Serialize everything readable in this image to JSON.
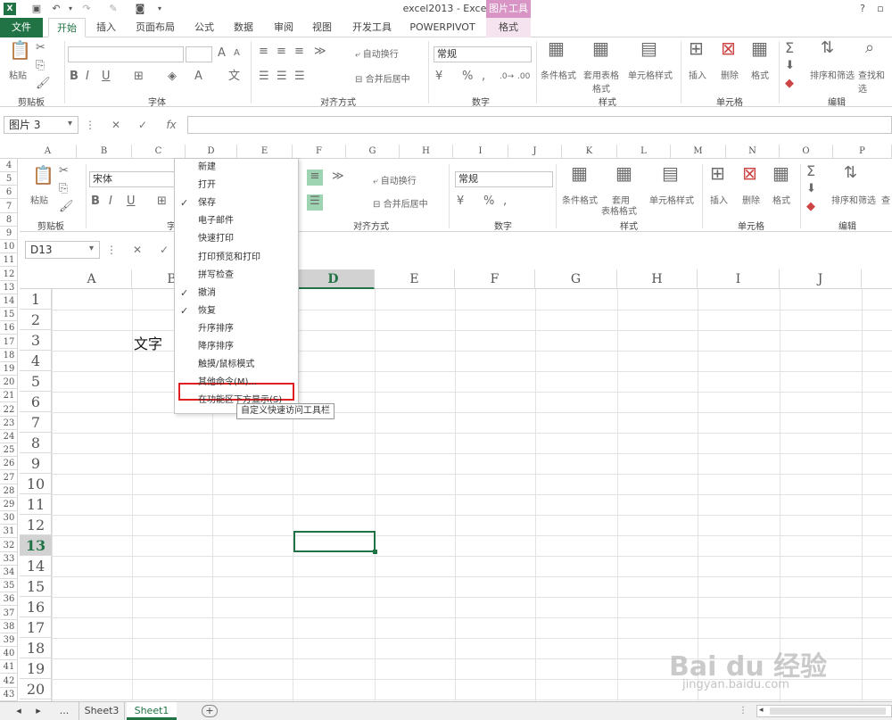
{
  "window": {
    "title": "excel2013 - Excel",
    "contextual_tab_group": "图片工具",
    "help": "?"
  },
  "tabs": [
    "文件",
    "开始",
    "插入",
    "页面布局",
    "公式",
    "数据",
    "审阅",
    "视图",
    "开发工具",
    "POWERPIVOT",
    "格式"
  ],
  "ribbon1": {
    "clipboard": {
      "paste": "粘贴",
      "group": "剪贴板"
    },
    "font": {
      "group": "字体",
      "bold": "B",
      "italic": "I",
      "underline": "U"
    },
    "alignment": {
      "wrap": "自动换行",
      "merge": "合并后居中",
      "group": "对齐方式"
    },
    "number": {
      "format": "常规",
      "group": "数字",
      "percent": "%"
    },
    "styles": {
      "conditional": "条件格式",
      "table": "套用表格格式",
      "cell": "单元格样式",
      "group": "样式"
    },
    "cells": {
      "insert": "插入",
      "delete": "删除",
      "format": "格式",
      "group": "单元格"
    },
    "editing": {
      "sort": "排序和筛选",
      "find": "查找和选",
      "group": "编辑"
    }
  },
  "formula_bar1": {
    "namebox": "图片 3",
    "fx": "fx"
  },
  "ribbon2": {
    "font_name": "宋体",
    "paste": "粘贴",
    "clipboard": "剪贴板",
    "font_group": "字",
    "wrap": "自动换行",
    "merge": "合并后居中",
    "align_group": "对齐方式",
    "number_format": "常规",
    "number_group": "数字",
    "conditional": "条件格式",
    "table": "套用",
    "table2": "表格格式",
    "cell": "单元格样式",
    "styles_group": "样式",
    "insert": "插入",
    "delete": "删除",
    "format": "格式",
    "cells_group": "单元格",
    "sort": "排序和筛选",
    "find": "查",
    "edit_group": "编辑"
  },
  "formula_bar2": {
    "namebox": "D13"
  },
  "outer_columns": [
    "A",
    "B",
    "C",
    "D",
    "E",
    "F",
    "G",
    "H",
    "I",
    "J",
    "K",
    "L",
    "M",
    "N",
    "O",
    "P"
  ],
  "outer_rows": [
    "4",
    "5",
    "6",
    "7",
    "8",
    "9",
    "10",
    "11",
    "12",
    "13",
    "14",
    "15",
    "16",
    "17",
    "18",
    "19",
    "20",
    "21",
    "22",
    "23",
    "24",
    "25",
    "26",
    "27",
    "28",
    "29",
    "30",
    "31",
    "32",
    "33",
    "34",
    "35",
    "36",
    "37",
    "38",
    "39",
    "40",
    "41",
    "42",
    "43"
  ],
  "inner_columns": [
    "A",
    "B",
    "C",
    "D",
    "E",
    "F",
    "G",
    "H",
    "I",
    "J"
  ],
  "inner_rows": [
    "1",
    "2",
    "3",
    "4",
    "5",
    "6",
    "7",
    "8",
    "9",
    "10",
    "11",
    "12",
    "13",
    "14",
    "15",
    "16",
    "17",
    "18",
    "19",
    "20"
  ],
  "cell_text": "文字",
  "menu": {
    "items": [
      {
        "label": "新建",
        "checked": false
      },
      {
        "label": "打开",
        "checked": false
      },
      {
        "label": "保存",
        "checked": true
      },
      {
        "label": "电子邮件",
        "checked": false
      },
      {
        "label": "快速打印",
        "checked": false
      },
      {
        "label": "打印预览和打印",
        "checked": false
      },
      {
        "label": "拼写检查",
        "checked": false
      },
      {
        "label": "撤消",
        "checked": true
      },
      {
        "label": "恢复",
        "checked": true
      },
      {
        "label": "升序排序",
        "checked": false
      },
      {
        "label": "降序排序",
        "checked": false
      },
      {
        "label": "触摸/鼠标模式",
        "checked": false
      },
      {
        "label": "其他命令(M)...",
        "checked": false
      },
      {
        "label": "在功能区下方显示(S)",
        "checked": false
      }
    ]
  },
  "tooltip": "自定义快速访问工具栏",
  "sheets": {
    "more": "...",
    "tabs": [
      "Sheet3",
      "Sheet1"
    ],
    "active": "Sheet1",
    "add": "+"
  },
  "watermark": {
    "brand": "Bai du 经验",
    "url": "jingyan.baidu.com"
  },
  "colors": {
    "excel_green": "#217346",
    "highlight_red": "#e02020",
    "context_tab": "#d894c4"
  }
}
